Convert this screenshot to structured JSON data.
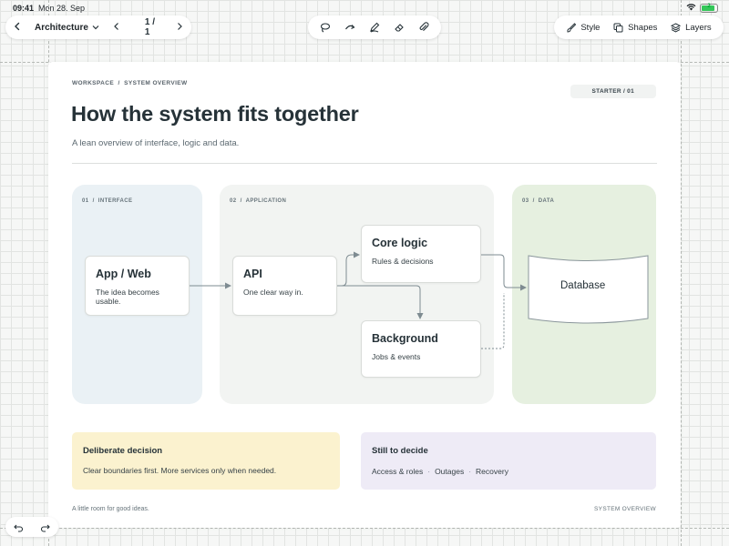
{
  "status": {
    "time": "09:41",
    "date": "Mon 28. Sep",
    "battery_level": 0.9,
    "battery_label": "2"
  },
  "toolbar": {
    "document_name": "Architecture",
    "page_indicator": "1 / 1",
    "style_label": "Style",
    "shapes_label": "Shapes",
    "layers_label": "Layers"
  },
  "page": {
    "breadcrumb": "WORKSPACE  /  SYSTEM OVERVIEW",
    "badge": "STARTER / 01",
    "title": "How the system fits together",
    "subtitle": "A lean overview of interface, logic and data.",
    "zones": [
      {
        "label": "01  /  INTERFACE",
        "color": "#eaf1f5"
      },
      {
        "label": "02  /  APPLICATION",
        "color": "#f2f4f2"
      },
      {
        "label": "03  /  DATA",
        "color": "#e6f0e0"
      }
    ],
    "nodes": {
      "app_web": {
        "title": "App / Web",
        "desc": "The idea becomes usable."
      },
      "api": {
        "title": "API",
        "desc": "One clear way in."
      },
      "core_logic": {
        "title": "Core logic",
        "desc": "Rules & decisions"
      },
      "background": {
        "title": "Background",
        "desc": "Jobs & events"
      },
      "database": {
        "title": "Database"
      }
    },
    "cards": {
      "decision": {
        "title": "Deliberate decision",
        "text": "Clear boundaries first. More services only when needed.",
        "color": "#fbf2cf"
      },
      "todo": {
        "title": "Still to decide",
        "items": [
          "Access & roles",
          "Outages",
          "Recovery"
        ],
        "separator": "·",
        "color": "#eeebf6"
      }
    },
    "footer_left": "A little room for good ideas.",
    "footer_right": "SYSTEM OVERVIEW"
  }
}
